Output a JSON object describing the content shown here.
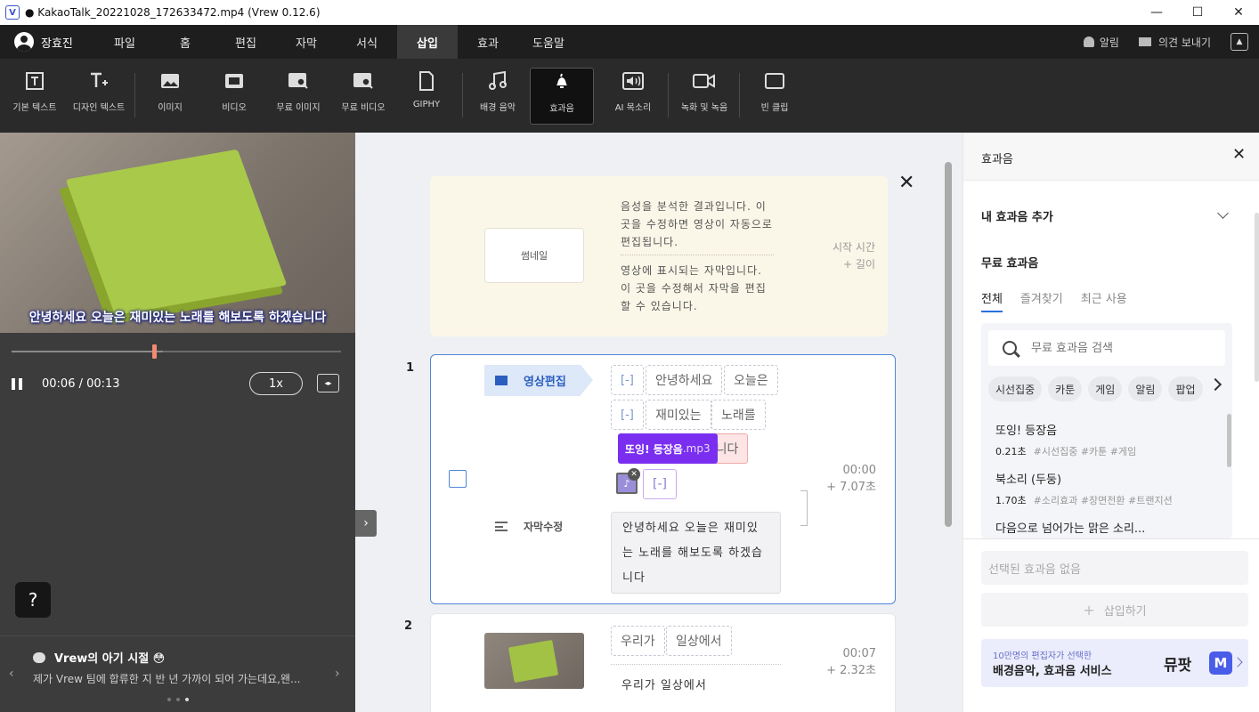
{
  "window": {
    "title": "● KakaoTalk_20221028_172633472.mp4 (Vrew 0.12.6)",
    "app_icon": "V",
    "controls": [
      "—",
      "☐",
      "✕"
    ]
  },
  "menubar": {
    "user": "장효진",
    "tabs": [
      "파일",
      "홈",
      "편집",
      "자막",
      "서식",
      "삽입",
      "효과",
      "도움말"
    ],
    "active_tab": "삽입",
    "alarm": "알림",
    "feedback": "의견 보내기"
  },
  "toolbar": {
    "items": [
      {
        "label": "기본 텍스트",
        "icon": "text-box-icon"
      },
      {
        "label": "디자인 텍스트",
        "icon": "design-text-icon"
      },
      {
        "label": "이미지",
        "icon": "image-icon"
      },
      {
        "label": "비디오",
        "icon": "video-icon"
      },
      {
        "label": "무료 이미지",
        "icon": "free-image-icon"
      },
      {
        "label": "무료 비디오",
        "icon": "free-video-icon"
      },
      {
        "label": "GIPHY",
        "icon": "giphy-icon"
      },
      {
        "label": "배경 음악",
        "icon": "music-icon"
      },
      {
        "label": "효과음",
        "icon": "bell-icon"
      },
      {
        "label": "AI 목소리",
        "icon": "ai-voice-icon"
      },
      {
        "label": "녹화 및 녹음",
        "icon": "record-icon"
      },
      {
        "label": "빈 클립",
        "icon": "blank-clip-icon"
      }
    ],
    "active_item": "효과음"
  },
  "player": {
    "caption": "안녕하세요 오늘은 재미있는 노래를 해보도록 하겠습니다",
    "time": "00:06 / 00:13",
    "speed": "1x",
    "progress_fraction": 0.46
  },
  "help": {
    "label": "?"
  },
  "tip": {
    "title": "Vrew의 아기 시절 😳",
    "body": "제가 Vrew 팀에 합류한 지 반 년 가까이 되어 가는데요,왠...",
    "prev": "‹",
    "next": "›",
    "dots": 3,
    "active_dot": 2
  },
  "guide": {
    "thumbnail": "썸네일",
    "audio_text": "음성을 분석한 결과입니다. 이 곳을 수정하면 영상이 자동으로 편집됩니다.",
    "subtitle_text": "영상에 표시되는 자막입니다. 이 곳을 수정해서 자막을 편집할 수 있습니다.",
    "time_label": "시작 시간",
    "length_label": "+ 길이"
  },
  "clips": [
    {
      "number": "1",
      "edit_label": "영상편집",
      "subtitle_label": "자막수정",
      "words": [
        "[-]",
        "안녕하세요",
        "오늘은",
        "[-]",
        "재미있는",
        "노래를",
        "하겠습니다",
        "[-]"
      ],
      "sfx_name": "또잉! 등장음",
      "sfx_ext": ".mp3",
      "subtitle": "안녕하세요 오늘은 재미있는 노래를 해보도록 하겠습니다",
      "start": "00:00",
      "length": "+ 7.07초"
    },
    {
      "number": "2",
      "words": [
        "우리가",
        "일상에서"
      ],
      "subtitle": "우리가 일상에서",
      "start": "00:07",
      "length": "+ 2.32초"
    }
  ],
  "sfx_panel": {
    "title": "효과음",
    "my_sfx": "내 효과음 추가",
    "free_sfx": "무료 효과음",
    "tabs": [
      "전체",
      "즐겨찾기",
      "최근 사용"
    ],
    "active_tab": "전체",
    "search_placeholder": "무료 효과음 검색",
    "chips": [
      "시선집중",
      "카툰",
      "게임",
      "알림",
      "팝업"
    ],
    "items": [
      {
        "name": "또잉! 등장음",
        "duration": "0.21초",
        "tags": "#시선집중 #카툰 #게임"
      },
      {
        "name": "북소리 (두둥)",
        "duration": "1.70초",
        "tags": "#소리효과 #장면전환 #트랜지션"
      },
      {
        "name": "다음으로 넘어가는 맑은 소리...",
        "duration": "",
        "tags": ""
      }
    ],
    "selected": "선택된 효과음 없음",
    "insert": "삽입하기",
    "banner_small": "10만명의 편집자가 선택한",
    "banner_big": "배경음악, 효과음 서비스",
    "banner_brand": "뮤팟",
    "banner_logo": "M"
  }
}
